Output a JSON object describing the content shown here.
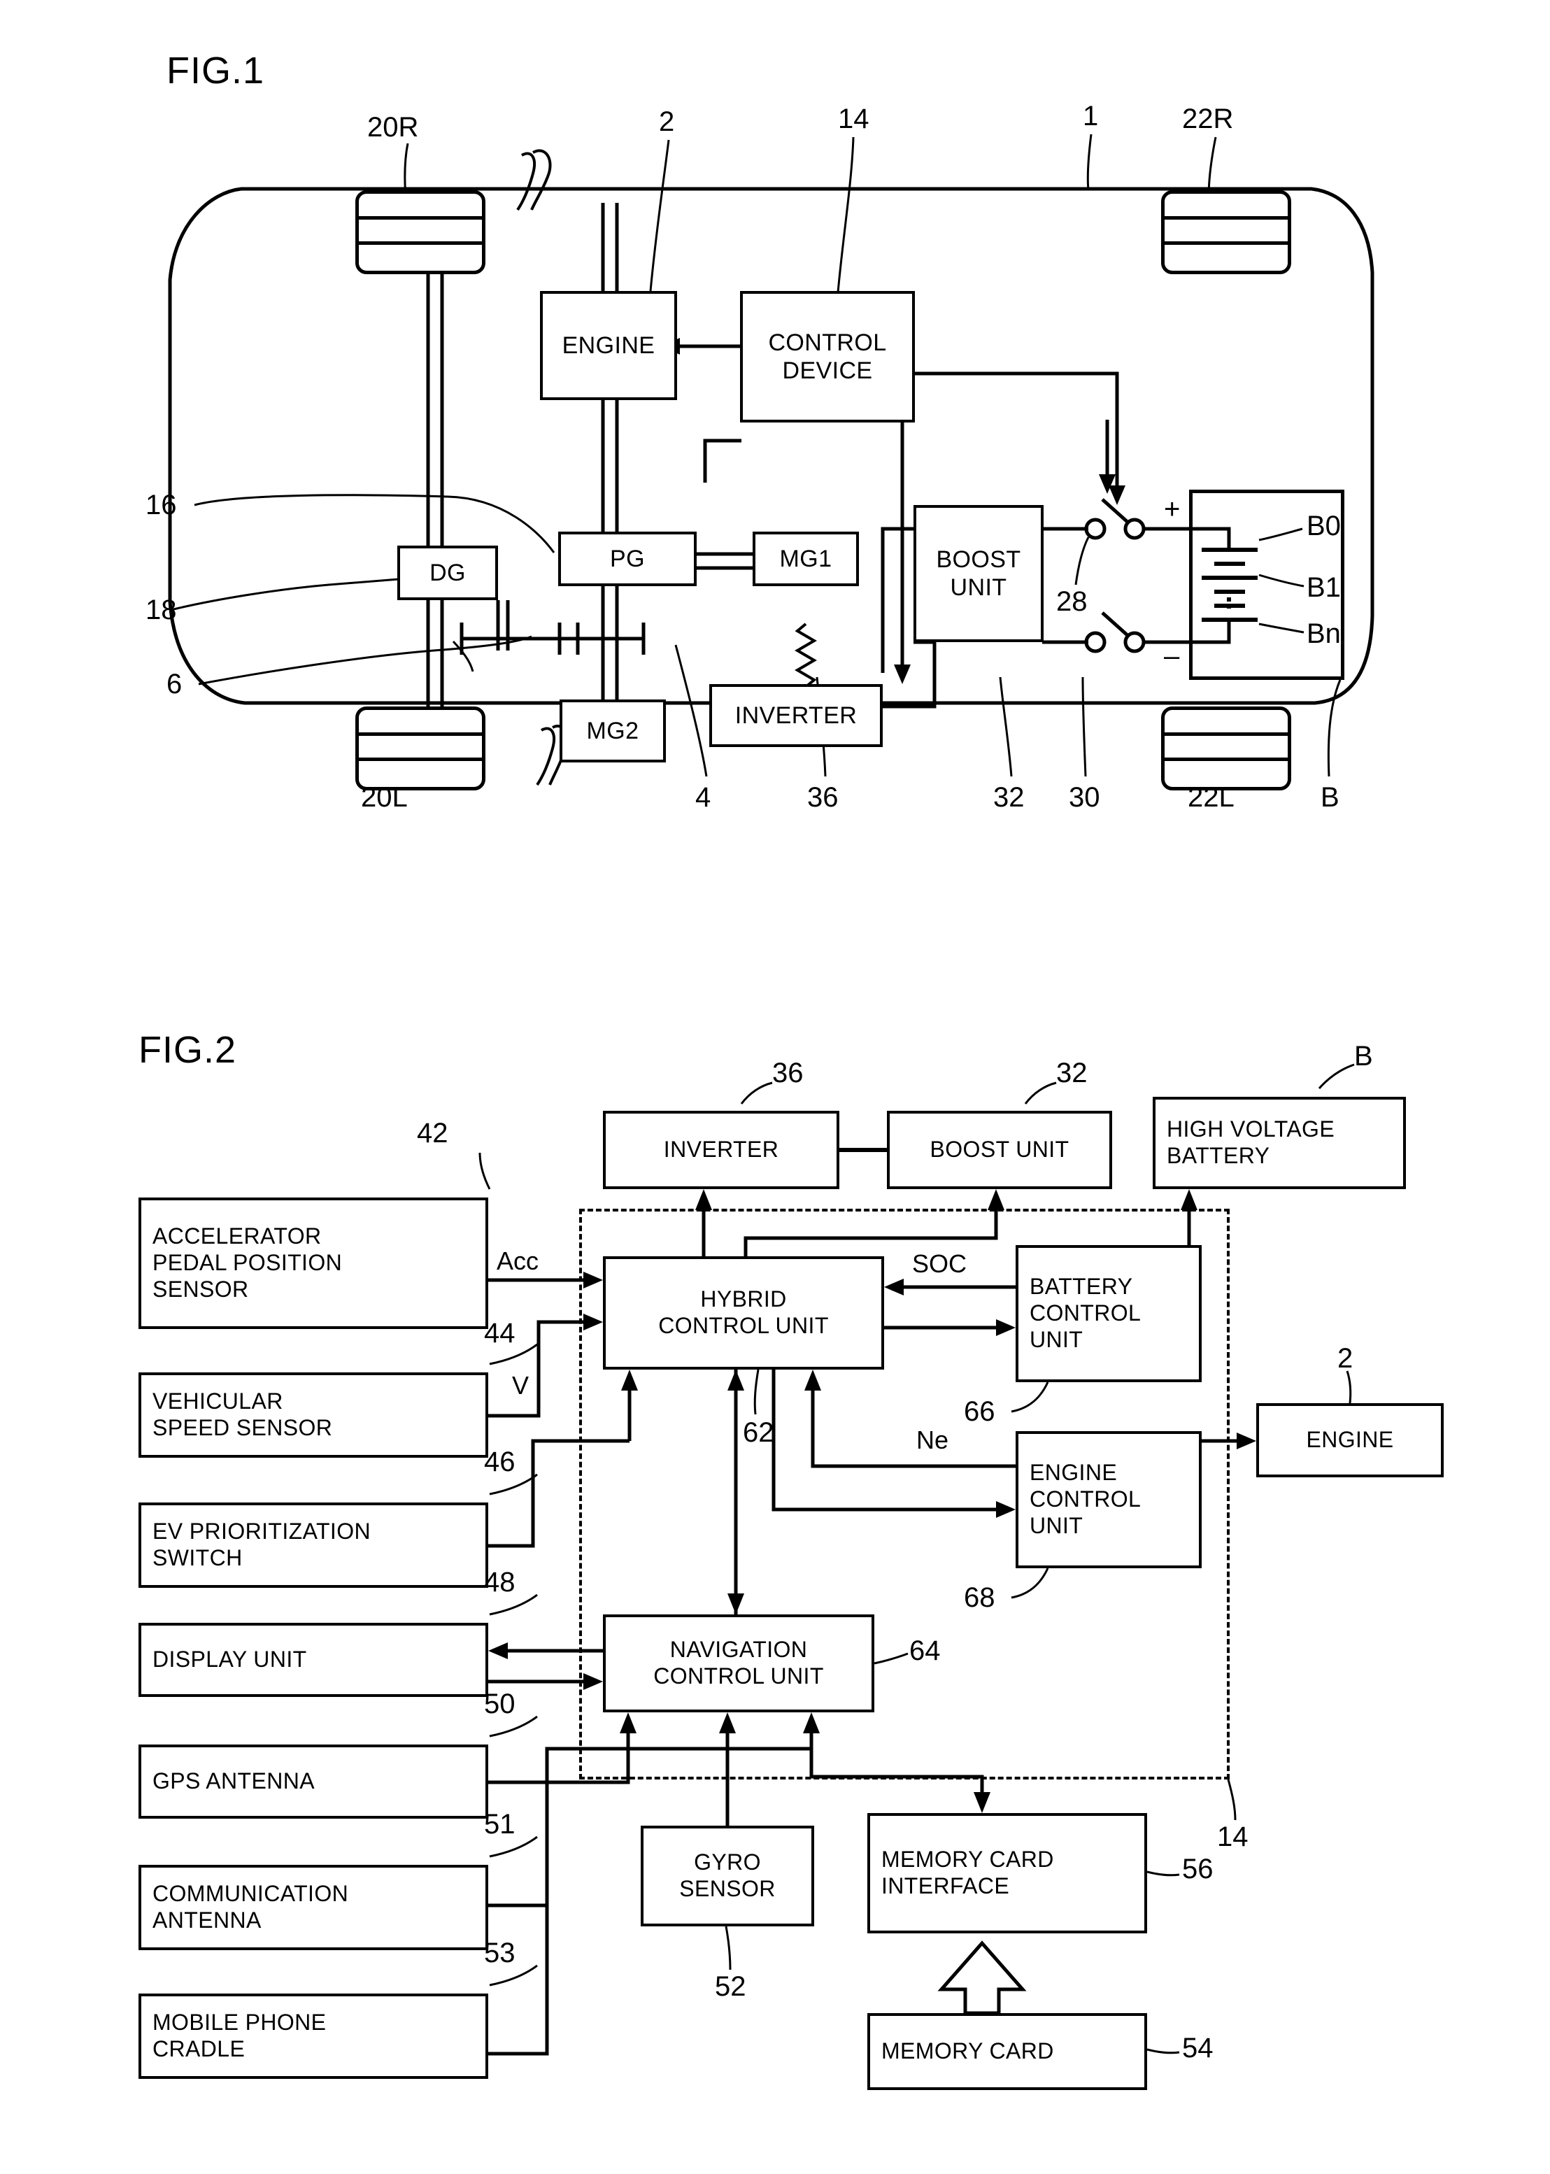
{
  "figures": [
    {
      "id": "fig1",
      "title": "FIG.1",
      "blocks": [
        {
          "key": "engine",
          "label": "ENGINE"
        },
        {
          "key": "control_device",
          "label": "CONTROL\nDEVICE"
        },
        {
          "key": "boost_unit",
          "label": "BOOST\nUNIT"
        },
        {
          "key": "dg",
          "label": "DG"
        },
        {
          "key": "pg",
          "label": "PG"
        },
        {
          "key": "mg1",
          "label": "MG1"
        },
        {
          "key": "mg2",
          "label": "MG2"
        },
        {
          "key": "inverter",
          "label": "INVERTER"
        }
      ],
      "battery_cells": [
        "B0",
        "B1",
        "Bn"
      ],
      "battery_terminals": {
        "positive": "+",
        "negative": "–"
      },
      "reference_numerals": [
        {
          "key": "r20R",
          "text": "20R"
        },
        {
          "key": "r2",
          "text": "2"
        },
        {
          "key": "r14",
          "text": "14"
        },
        {
          "key": "r1",
          "text": "1"
        },
        {
          "key": "r22R",
          "text": "22R"
        },
        {
          "key": "r16",
          "text": "16"
        },
        {
          "key": "r18",
          "text": "18"
        },
        {
          "key": "r6",
          "text": "6"
        },
        {
          "key": "r28",
          "text": "28"
        },
        {
          "key": "r20L",
          "text": "20L"
        },
        {
          "key": "r4",
          "text": "4"
        },
        {
          "key": "r36",
          "text": "36"
        },
        {
          "key": "r32",
          "text": "32"
        },
        {
          "key": "r30",
          "text": "30"
        },
        {
          "key": "r22L",
          "text": "22L"
        },
        {
          "key": "rB",
          "text": "B"
        }
      ]
    },
    {
      "id": "fig2",
      "title": "FIG.2",
      "blocks": [
        {
          "key": "inverter",
          "label": "INVERTER"
        },
        {
          "key": "boost_unit",
          "label": "BOOST UNIT"
        },
        {
          "key": "hv_battery",
          "label": "HIGH VOLTAGE\nBATTERY"
        },
        {
          "key": "accel_sensor",
          "label": "ACCELERATOR\nPEDAL POSITION\nSENSOR"
        },
        {
          "key": "speed_sensor",
          "label": "VEHICULAR\nSPEED SENSOR"
        },
        {
          "key": "ev_switch",
          "label": "EV PRIORITIZATION\nSWITCH"
        },
        {
          "key": "display_unit",
          "label": "DISPLAY UNIT"
        },
        {
          "key": "gps_antenna",
          "label": "GPS ANTENNA"
        },
        {
          "key": "comm_antenna",
          "label": "COMMUNICATION\nANTENNA"
        },
        {
          "key": "phone_cradle",
          "label": "MOBILE PHONE\nCRADLE"
        },
        {
          "key": "hybrid_cu",
          "label": "HYBRID\nCONTROL UNIT"
        },
        {
          "key": "battery_cu",
          "label": "BATTERY\nCONTROL\nUNIT"
        },
        {
          "key": "engine_cu",
          "label": "ENGINE\nCONTROL\nUNIT"
        },
        {
          "key": "navigation_cu",
          "label": "NAVIGATION\nCONTROL UNIT"
        },
        {
          "key": "engine",
          "label": "ENGINE"
        },
        {
          "key": "gyro_sensor",
          "label": "GYRO\nSENSOR"
        },
        {
          "key": "card_interface",
          "label": "MEMORY CARD\nINTERFACE"
        },
        {
          "key": "memory_card",
          "label": "MEMORY CARD"
        }
      ],
      "signals": [
        {
          "key": "acc",
          "text": "Acc"
        },
        {
          "key": "v",
          "text": "V"
        },
        {
          "key": "soc",
          "text": "SOC"
        },
        {
          "key": "ne",
          "text": "Ne"
        }
      ],
      "reference_numerals": [
        {
          "key": "r42",
          "text": "42"
        },
        {
          "key": "r44",
          "text": "44"
        },
        {
          "key": "r46",
          "text": "46"
        },
        {
          "key": "r48",
          "text": "48"
        },
        {
          "key": "r50",
          "text": "50"
        },
        {
          "key": "r51",
          "text": "51"
        },
        {
          "key": "r53",
          "text": "53"
        },
        {
          "key": "r36",
          "text": "36"
        },
        {
          "key": "r32",
          "text": "32"
        },
        {
          "key": "rB",
          "text": "B"
        },
        {
          "key": "r2",
          "text": "2"
        },
        {
          "key": "r62",
          "text": "62"
        },
        {
          "key": "r64",
          "text": "64"
        },
        {
          "key": "r66",
          "text": "66"
        },
        {
          "key": "r68",
          "text": "68"
        },
        {
          "key": "r52",
          "text": "52"
        },
        {
          "key": "r54",
          "text": "54"
        },
        {
          "key": "r56",
          "text": "56"
        },
        {
          "key": "r14",
          "text": "14"
        }
      ]
    }
  ],
  "colors": {
    "ink": "#000000",
    "paper": "#ffffff"
  }
}
